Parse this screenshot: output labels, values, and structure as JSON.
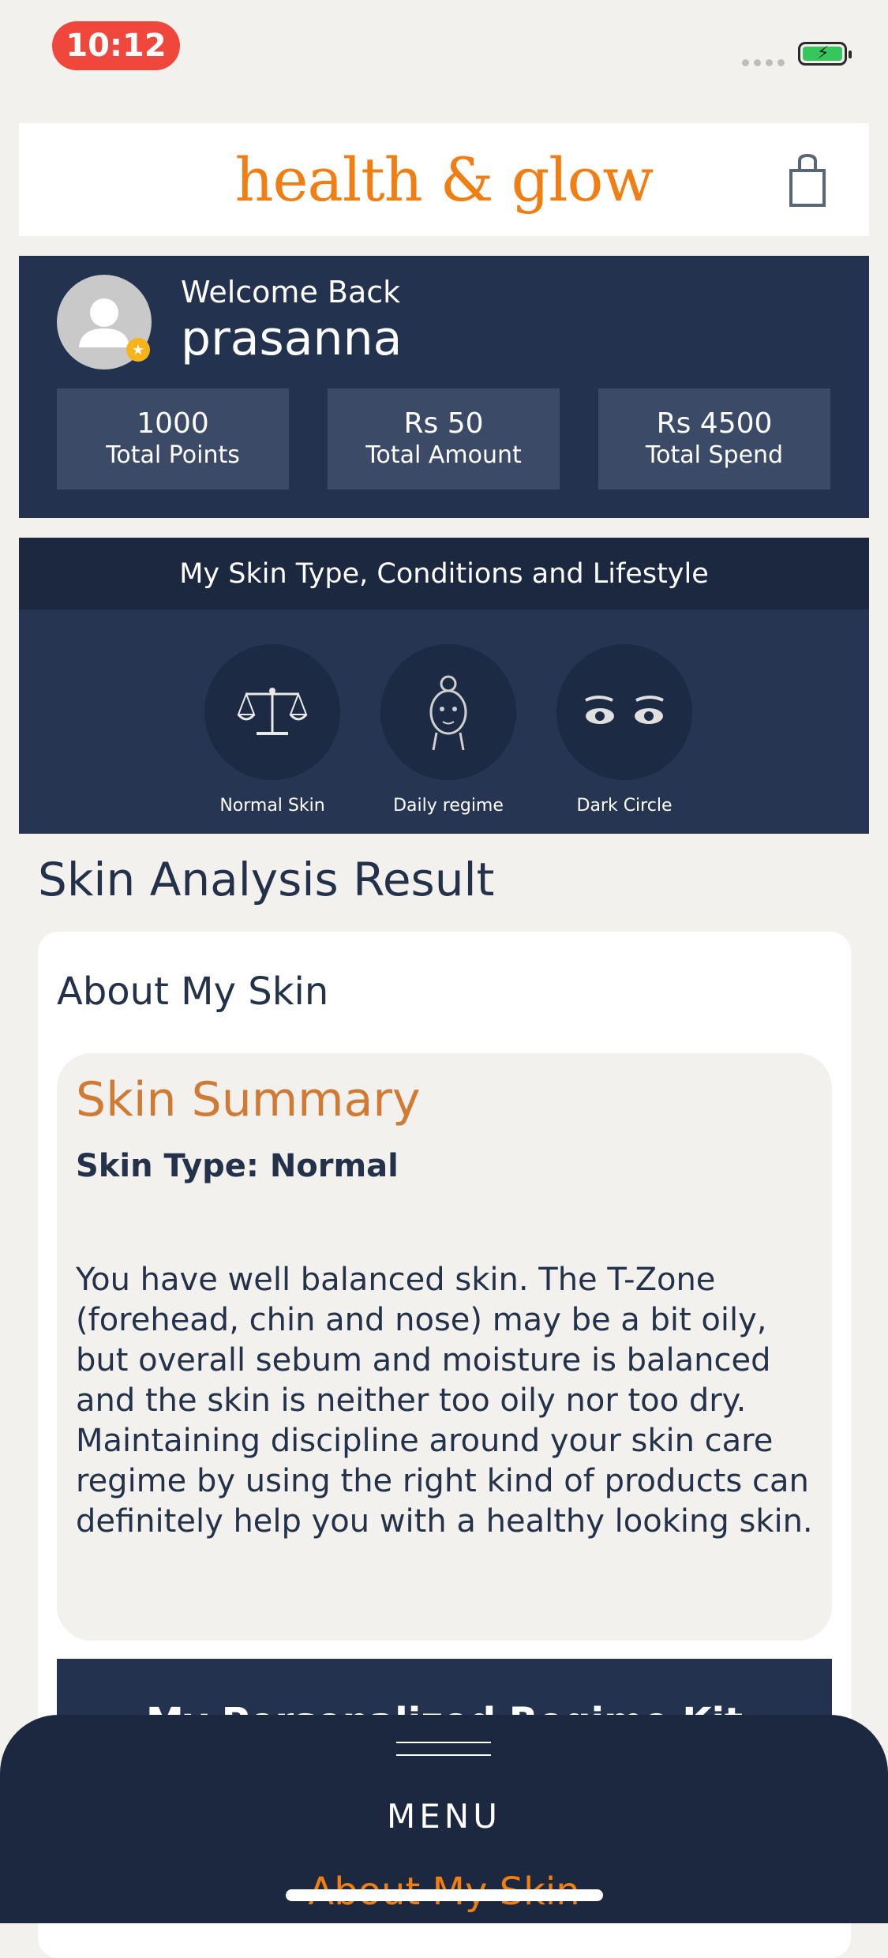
{
  "status_bar": {
    "time": "10:12"
  },
  "header": {
    "logo": "health & glow"
  },
  "profile": {
    "welcome": "Welcome Back",
    "name": "prasanna",
    "stats": [
      {
        "value": "1000",
        "label": "Total Points"
      },
      {
        "value": "Rs 50",
        "label": "Total Amount"
      },
      {
        "value": "Rs 4500",
        "label": "Total Spend"
      }
    ]
  },
  "conditions": {
    "title": "My Skin Type, Conditions and Lifestyle",
    "items": [
      {
        "label": "Normal Skin",
        "icon": "balance-scale-icon"
      },
      {
        "label": "Daily regime",
        "icon": "face-icon"
      },
      {
        "label": "Dark Circle",
        "icon": "eyes-icon"
      }
    ]
  },
  "analysis": {
    "section_title": "Skin Analysis Result",
    "about_title": "About My Skin",
    "summary_title": "Skin Summary",
    "skin_type": "Skin Type: Normal",
    "summary_text": "You have well balanced skin. The T-Zone (forehead, chin and nose) may be a bit oily, but overall sebum and moisture is balanced and the skin is neither too oily nor too dry. Maintaining discipline around your skin care regime by using the right kind of products can definitely help you with a healthy looking skin.",
    "kit_label": "My Personalized Regime Kit"
  },
  "menu": {
    "label": "MENU",
    "first_item": "About My Skin"
  },
  "colors": {
    "brand_orange": "#f07e12",
    "navy": "#23324e",
    "summary_orange": "#d17a34"
  }
}
